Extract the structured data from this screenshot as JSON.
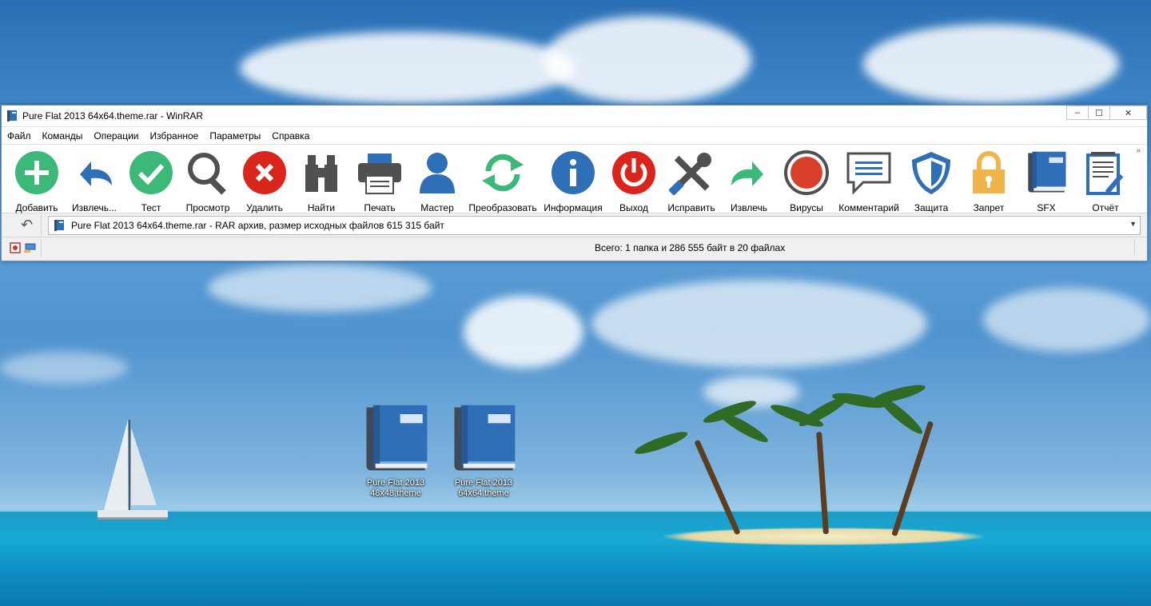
{
  "window": {
    "title": "Pure Flat 2013 64x64.theme.rar - WinRAR",
    "minimize": "–",
    "maximize": "☐",
    "close": "✕"
  },
  "menu": [
    "Файл",
    "Команды",
    "Операции",
    "Избранное",
    "Параметры",
    "Справка"
  ],
  "toolbar": [
    {
      "label": "Добавить",
      "icon": "add-icon",
      "color": "#3cb878"
    },
    {
      "label": "Извлечь...",
      "icon": "extract-to-icon",
      "color": "#2e6fb7"
    },
    {
      "label": "Тест",
      "icon": "test-check-icon",
      "color": "#3cb878"
    },
    {
      "label": "Просмотр",
      "icon": "view-magnifier-icon",
      "color": "#505050"
    },
    {
      "label": "Удалить",
      "icon": "delete-icon",
      "color": "#d9251c"
    },
    {
      "label": "Найти",
      "icon": "find-binoculars-icon",
      "color": "#505050"
    },
    {
      "label": "Печать",
      "icon": "print-icon",
      "color": "#505050"
    },
    {
      "label": "Мастер",
      "icon": "wizard-user-icon",
      "color": "#2e6fb7"
    },
    {
      "label": "Преобразовать",
      "icon": "convert-icon",
      "color": "#3cb878"
    },
    {
      "label": "Информация",
      "icon": "info-icon",
      "color": "#2e6fb7"
    },
    {
      "label": "Выход",
      "icon": "exit-power-icon",
      "color": "#d9251c"
    },
    {
      "label": "Исправить",
      "icon": "repair-tools-icon",
      "color": "#505050"
    },
    {
      "label": "Извлечь",
      "icon": "extract-icon",
      "color": "#3cb878"
    },
    {
      "label": "Вирусы",
      "icon": "virus-scan-icon",
      "color": "#d9402b"
    },
    {
      "label": "Комментарий",
      "icon": "comment-icon",
      "color": "#2e6fb7"
    },
    {
      "label": "Защита",
      "icon": "protect-shield-icon",
      "color": "#2e6fb7"
    },
    {
      "label": "Запрет",
      "icon": "lock-icon",
      "color": "#f0b44b"
    },
    {
      "label": "SFX",
      "icon": "sfx-book-icon",
      "color": "#2e6fb7"
    },
    {
      "label": "Отчёт",
      "icon": "report-icon",
      "color": "#2e6fb7"
    }
  ],
  "toolbar_more": "»",
  "address": {
    "back": "↶",
    "text": "Pure Flat 2013 64x64.theme.rar - RAR архив, размер исходных файлов 615 315 байт",
    "dropdown": "▼"
  },
  "status": {
    "text": "Всего: 1 папка и 286 555 байт в 20 файлах"
  },
  "desktop_icons": [
    {
      "label_line1": "Pure Flat 2013",
      "label_line2": "48x48.theme"
    },
    {
      "label_line1": "Pure Flat 2013",
      "label_line2": "64x64.theme"
    }
  ]
}
